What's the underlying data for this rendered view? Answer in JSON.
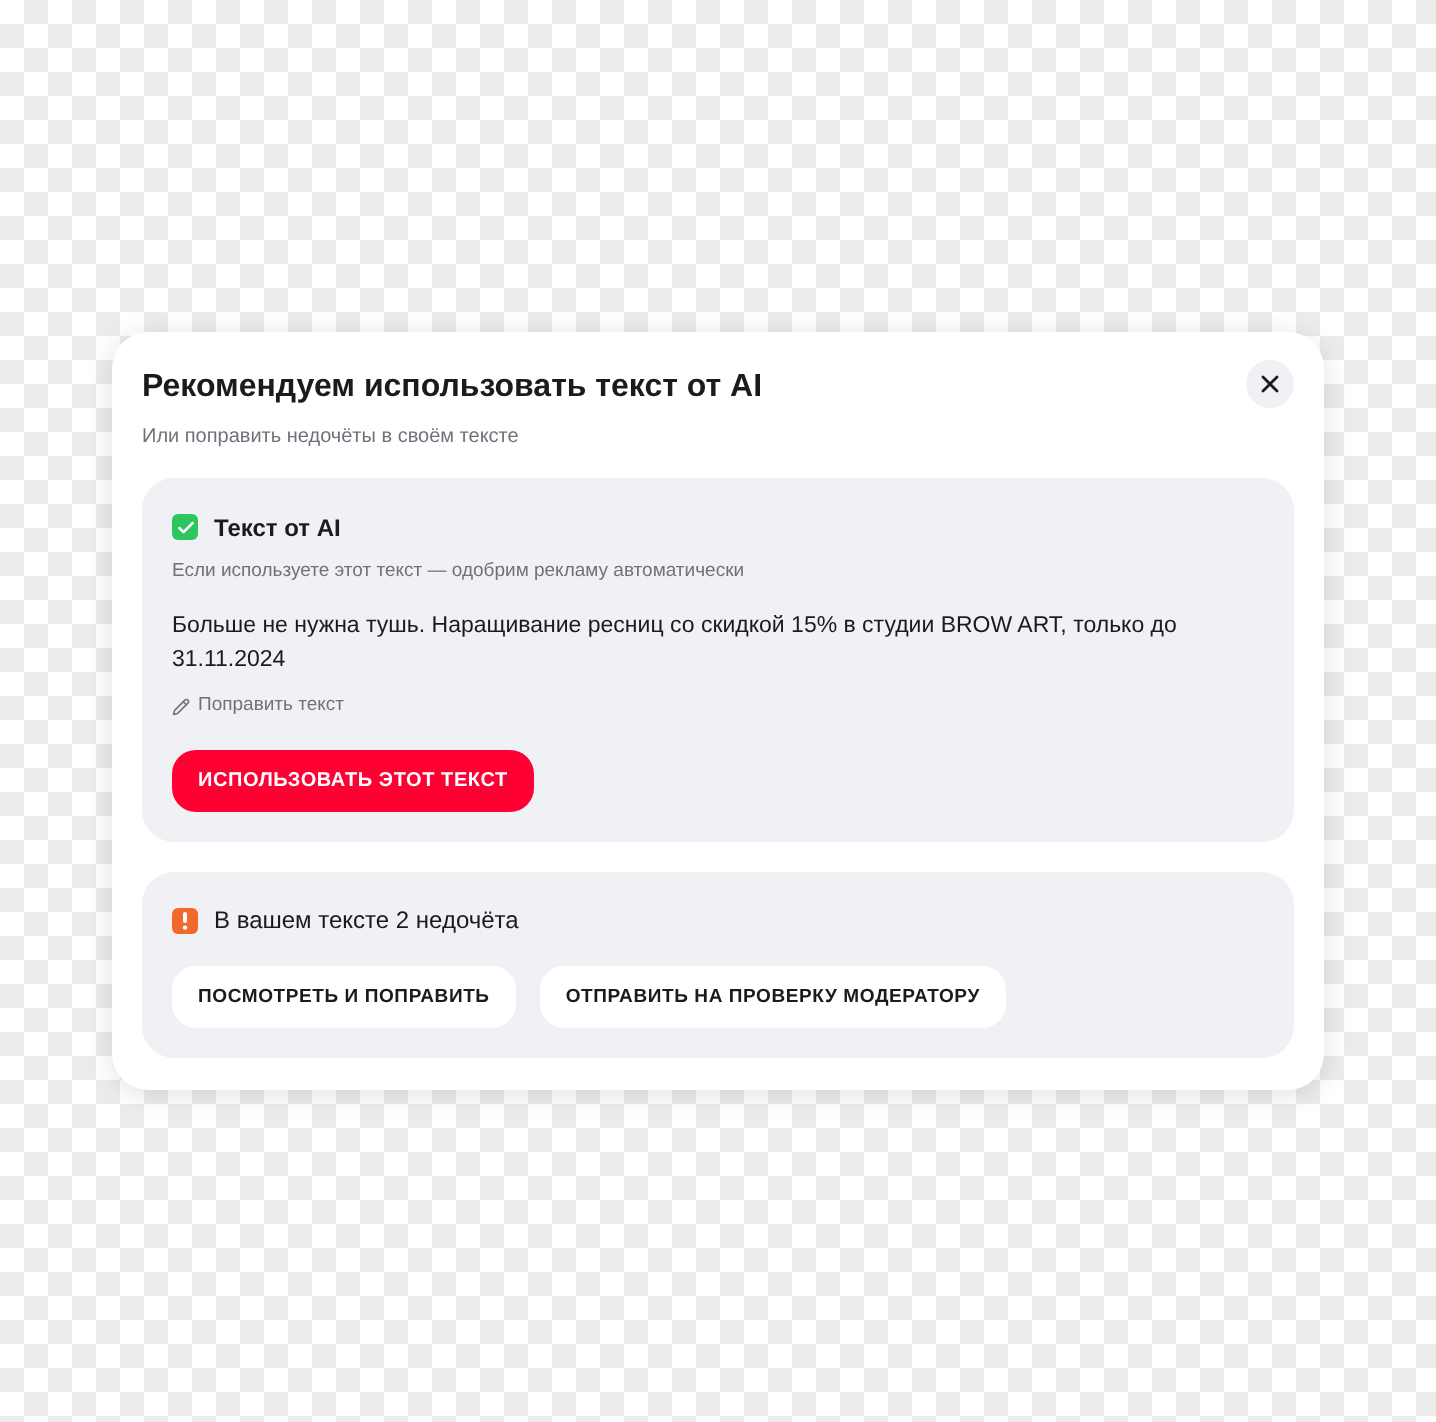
{
  "dialog": {
    "title": "Рекомендуем использовать текст от AI",
    "subtitle": "Или поправить недочёты в своём тексте",
    "ai_card": {
      "kind": "success",
      "title": "Текст от AI",
      "hint": "Если используете этот текст — одобрим рекламу автоматически",
      "text": "Больше не нужна тушь. Наращивание ресниц со скидкой 15% в студии BROW ART, только до 31.11.2024",
      "edit_link": "Поправить текст",
      "button": "ИСПОЛЬЗОВАТЬ ЭТОТ ТЕКСТ"
    },
    "issues_card": {
      "kind": "warning",
      "title": "В вашем тексте 2 недочёта",
      "buttons": [
        "ПОСМОТРЕТЬ И ПОПРАВИТЬ",
        "ОТПРАВИТЬ НА ПРОВЕРКУ МОДЕРАТОРУ"
      ]
    }
  }
}
